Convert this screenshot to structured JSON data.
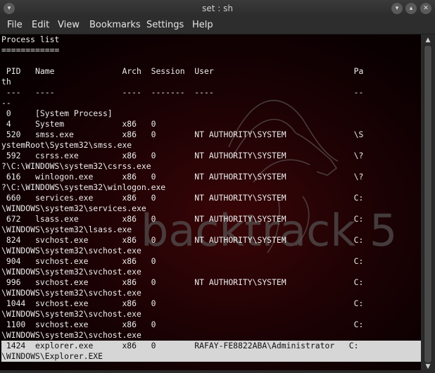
{
  "window": {
    "title": "set : sh"
  },
  "menu": [
    "File",
    "Edit",
    "View",
    "Bookmarks",
    "Settings",
    "Help"
  ],
  "terminal": {
    "lines": [
      "Process list",
      "============",
      "",
      " PID   Name              Arch  Session  User                             Pa",
      "th",
      " ---   ----              ----  -------  ----                             --",
      "--",
      " 0     [System Process]",
      " 4     System            x86   0",
      " 520   smss.exe          x86   0        NT AUTHORITY\\SYSTEM              \\S",
      "ystemRoot\\System32\\smss.exe",
      " 592   csrss.exe         x86   0        NT AUTHORITY\\SYSTEM              \\?",
      "?\\C:\\WINDOWS\\system32\\csrss.exe",
      " 616   winlogon.exe      x86   0        NT AUTHORITY\\SYSTEM              \\?",
      "?\\C:\\WINDOWS\\system32\\winlogon.exe",
      " 660   services.exe      x86   0        NT AUTHORITY\\SYSTEM              C:",
      "\\WINDOWS\\system32\\services.exe",
      " 672   lsass.exe         x86   0        NT AUTHORITY\\SYSTEM              C:",
      "\\WINDOWS\\system32\\lsass.exe",
      " 824   svchost.exe       x86   0        NT AUTHORITY\\SYSTEM              C:",
      "\\WINDOWS\\system32\\svchost.exe",
      " 904   svchost.exe       x86   0                                         C:",
      "\\WINDOWS\\system32\\svchost.exe",
      " 996   svchost.exe       x86   0        NT AUTHORITY\\SYSTEM              C:",
      "\\WINDOWS\\system32\\svchost.exe",
      " 1044  svchost.exe       x86   0                                         C:",
      "\\WINDOWS\\system32\\svchost.exe",
      " 1100  svchost.exe       x86   0                                         C:",
      "\\WINDOWS\\system32\\svchost.exe",
      " 1424  explorer.exe      x86   0        RAFAY-FE8822ABA\\Administrator   C:",
      "\\WINDOWS\\Explorer.EXE"
    ]
  },
  "logo_text": "backtrack 5",
  "colors": {
    "terminal_bg": "#0a0001",
    "highlight": "#d6d6d6",
    "text": "#ececec"
  }
}
